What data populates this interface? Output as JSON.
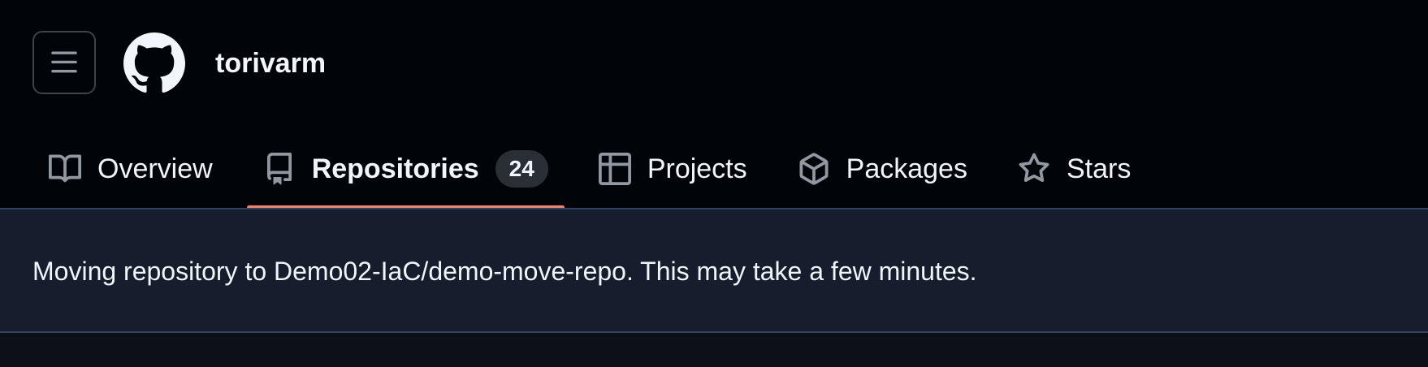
{
  "header": {
    "menu_icon": "hamburger-icon",
    "logo_icon": "github-mark-icon",
    "username": "torivarm"
  },
  "tabs": [
    {
      "label": "Overview",
      "icon": "book-icon",
      "active": false
    },
    {
      "label": "Repositories",
      "icon": "repo-icon",
      "active": true,
      "count": "24"
    },
    {
      "label": "Projects",
      "icon": "table-icon",
      "active": false
    },
    {
      "label": "Packages",
      "icon": "package-icon",
      "active": false
    },
    {
      "label": "Stars",
      "icon": "star-icon",
      "active": false
    }
  ],
  "flash": {
    "message": "Moving repository to Demo02-IaC/demo-move-repo. This may take a few minutes."
  },
  "colors": {
    "header_bg": "#010409",
    "page_bg": "#0d1117",
    "flash_bg": "#161d2d",
    "flash_border": "#2f4266",
    "active_underline": "#f78166",
    "icon_gray": "#9198a1"
  }
}
